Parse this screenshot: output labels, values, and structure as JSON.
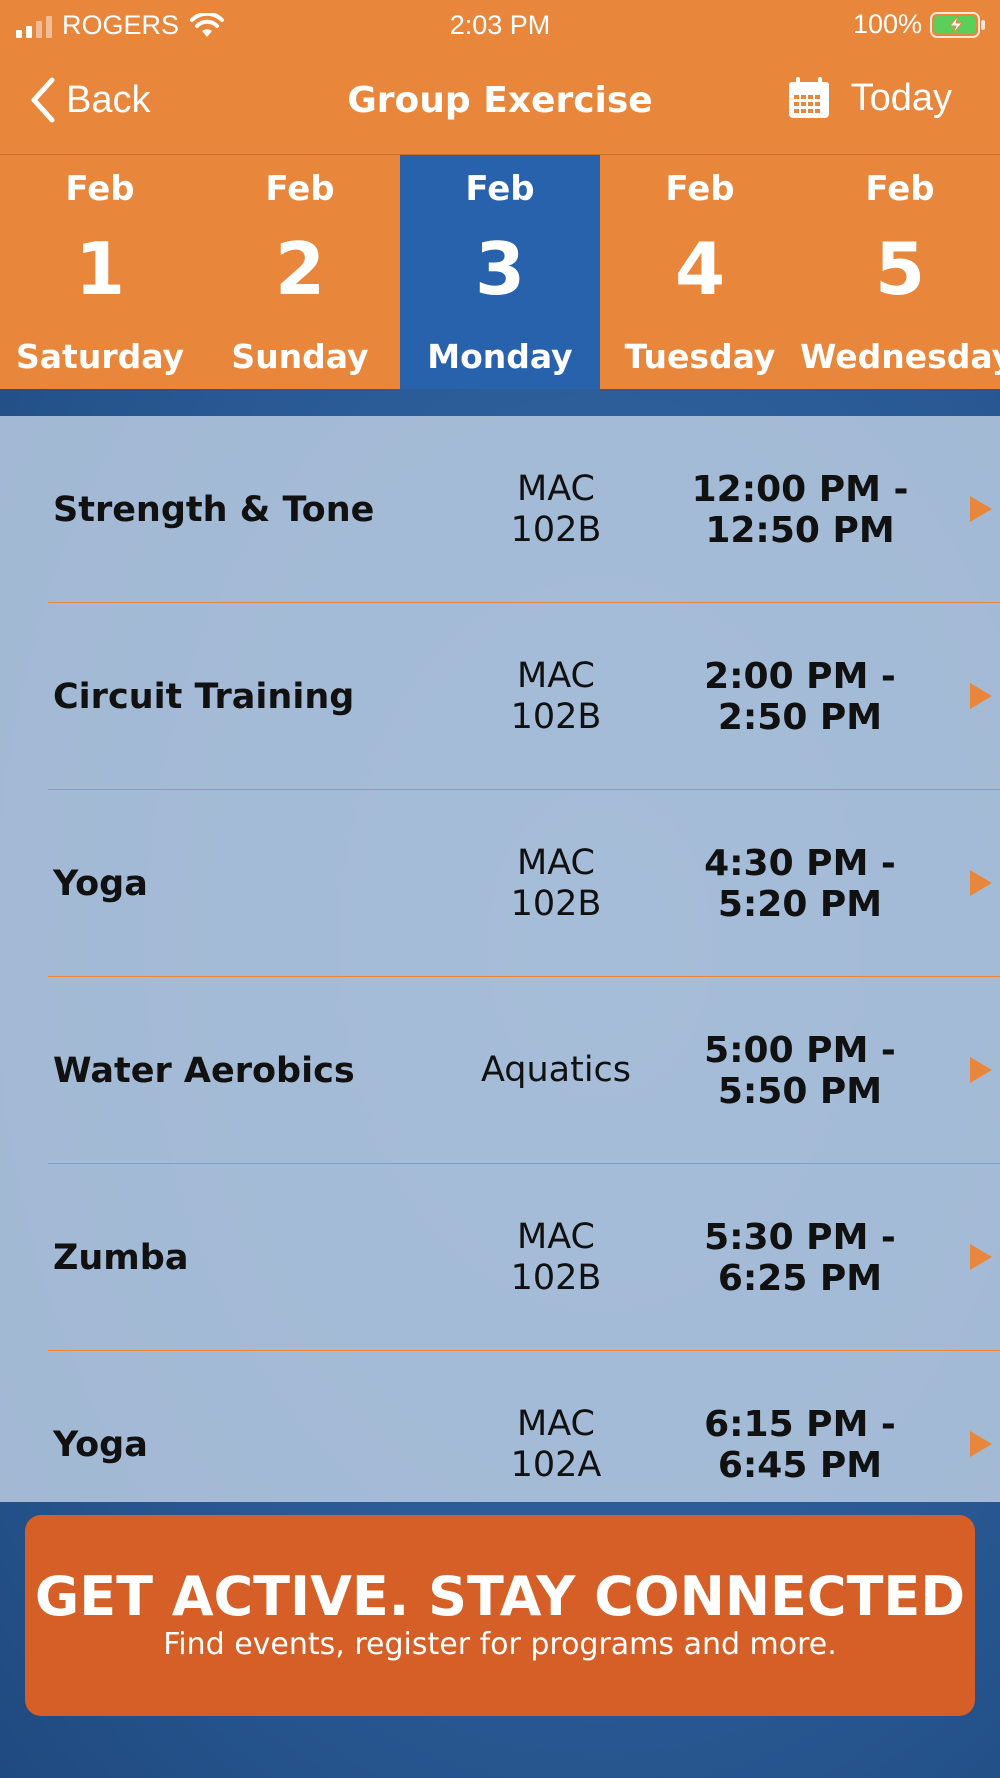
{
  "status_bar": {
    "carrier": "ROGERS",
    "time": "2:03 PM",
    "battery": "100%"
  },
  "nav": {
    "back_label": "Back",
    "title": "Group Exercise",
    "today_label": "Today"
  },
  "dates": [
    {
      "month": "Feb",
      "day": "1",
      "weekday": "Saturday",
      "selected": false
    },
    {
      "month": "Feb",
      "day": "2",
      "weekday": "Sunday",
      "selected": false
    },
    {
      "month": "Feb",
      "day": "3",
      "weekday": "Monday",
      "selected": true
    },
    {
      "month": "Feb",
      "day": "4",
      "weekday": "Tuesday",
      "selected": false
    },
    {
      "month": "Feb",
      "day": "5",
      "weekday": "Wednesday",
      "selected": false
    }
  ],
  "classes": [
    {
      "name": "Strength & Tone",
      "location": "MAC\n102B",
      "time": "12:00 PM -\n12:50 PM"
    },
    {
      "name": "Circuit Training",
      "location": "MAC\n102B",
      "time": "2:00 PM -\n2:50 PM"
    },
    {
      "name": "Yoga",
      "location": "MAC\n102B",
      "time": "4:30 PM -\n5:20 PM"
    },
    {
      "name": "Water Aerobics",
      "location": "Aquatics",
      "time": "5:00 PM -\n5:50 PM"
    },
    {
      "name": "Zumba",
      "location": "MAC\n102B",
      "time": "5:30 PM -\n6:25 PM"
    },
    {
      "name": "Yoga",
      "location": "MAC\n102A",
      "time": "6:15 PM -\n6:45 PM"
    }
  ],
  "banner": {
    "title": "GET ACTIVE.  STAY CONNECTED",
    "subtitle": "Find events, register for programs and more."
  },
  "colors": {
    "accent_orange": "#e8873c",
    "selected_blue": "#2862ad",
    "banner_orange": "#d55f26"
  }
}
